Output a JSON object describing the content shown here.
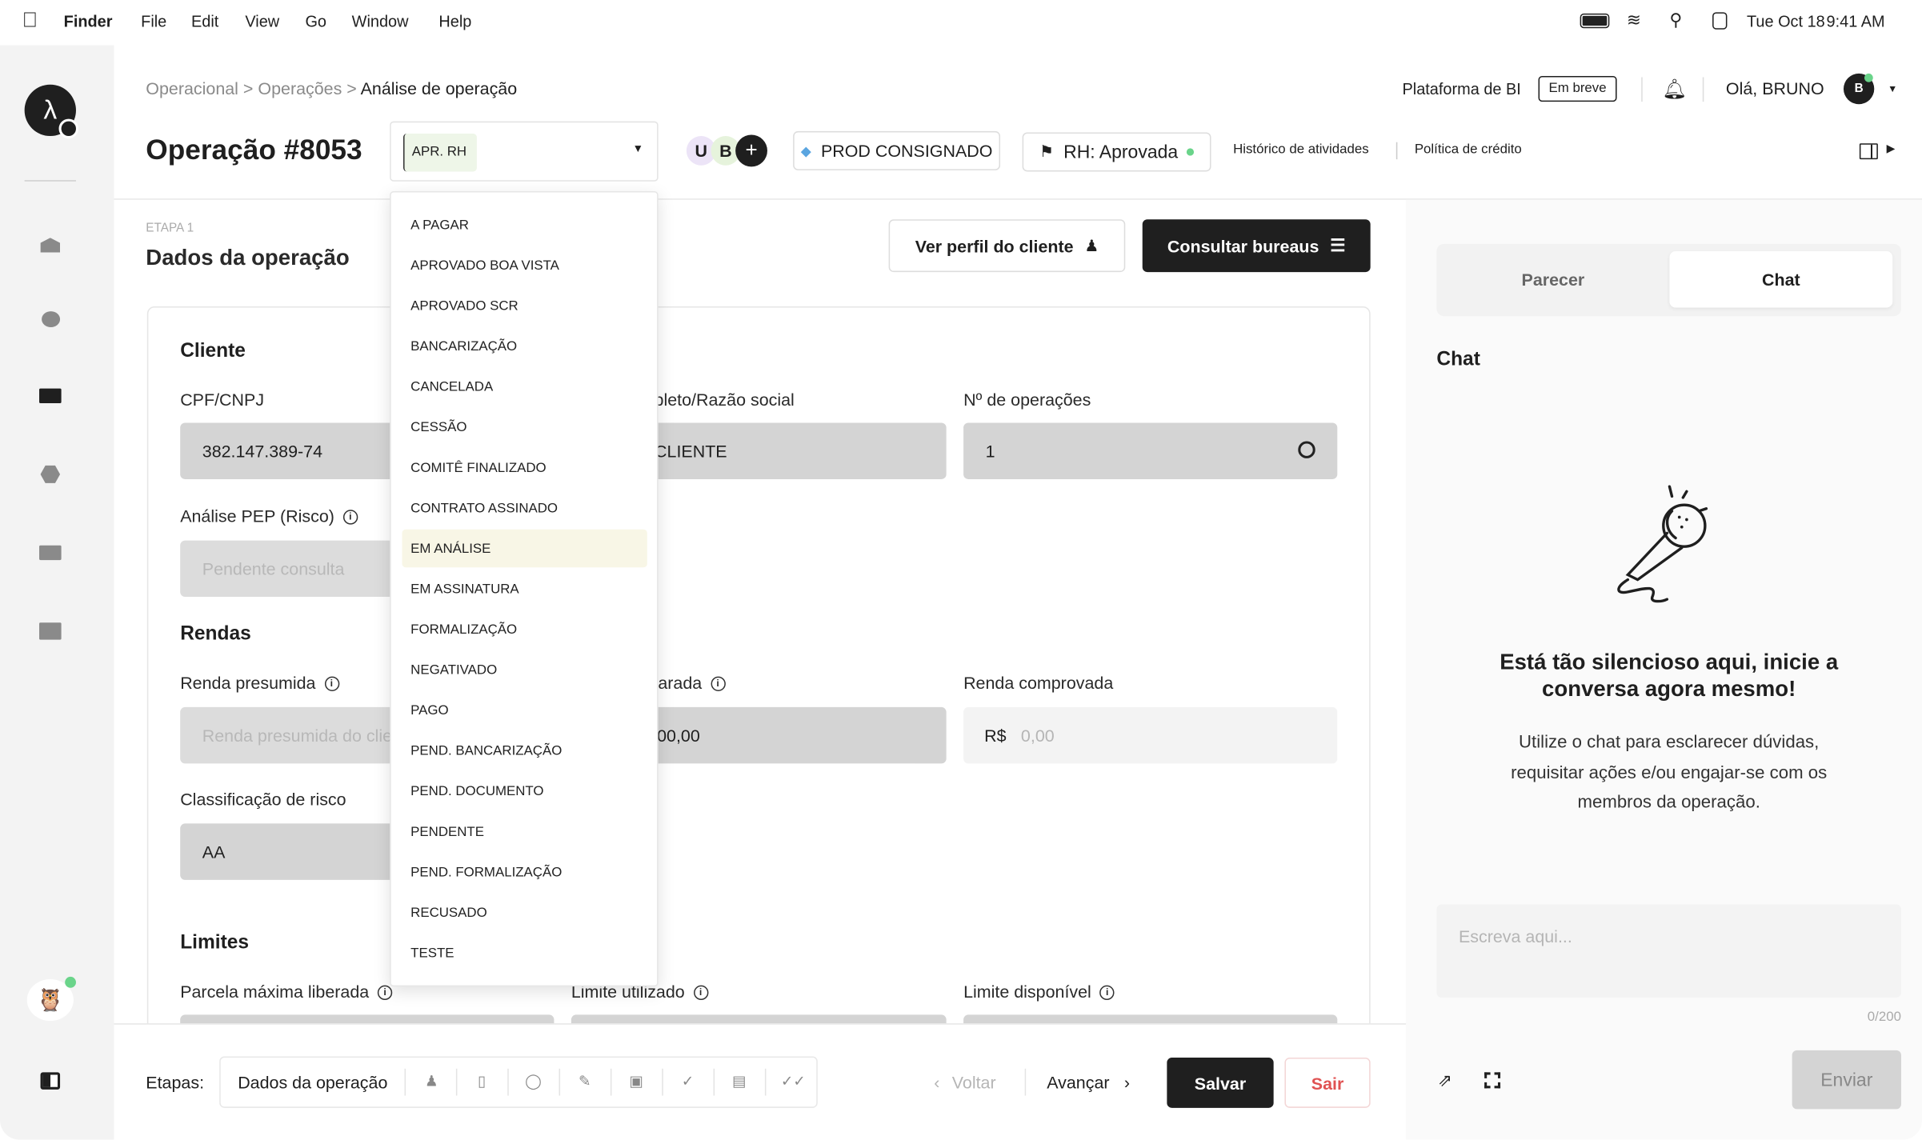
{
  "menubar": {
    "app": "Finder",
    "items": [
      "File",
      "Edit",
      "View",
      "Go",
      "Window",
      "Help"
    ],
    "date": "Tue Oct 18",
    "time": "9:41 AM"
  },
  "breadcrumb": {
    "items": [
      "Operacional",
      "Operações"
    ],
    "separator": ">",
    "current": "Análise de operação"
  },
  "header": {
    "title": "Operação #8053",
    "status_select": {
      "value": "APR. RH"
    },
    "avatars": [
      "U",
      "B"
    ],
    "add_label": "+",
    "product_tag": "PROD CONSIGNADO",
    "rh_status": "RH: Aprovada",
    "link_history": "Histórico de atividades",
    "link_policy": "Política de crédito",
    "bi_label": "Plataforma de BI",
    "bi_badge": "Em breve",
    "greeting": "Olá, BRUNO",
    "user_initial": "B"
  },
  "status_options": [
    "A PAGAR",
    "APROVADO BOA VISTA",
    "APROVADO SCR",
    "BANCARIZAÇÃO",
    "CANCELADA",
    "CESSÃO",
    "COMITÊ FINALIZADO",
    "CONTRATO ASSINADO",
    "EM ANÁLISE",
    "EM ASSINATURA",
    "FORMALIZAÇÃO",
    "NEGATIVADO",
    "PAGO",
    "PEND. BANCARIZAÇÃO",
    "PEND. DOCUMENTO",
    "PENDENTE",
    "PEND. FORMALIZAÇÃO",
    "RECUSADO",
    "TESTE"
  ],
  "highlighted_option": "EM ANÁLISE",
  "stage": {
    "step": "ETAPA 1",
    "title": "Dados da operação",
    "btn_profile": "Ver perfil do cliente",
    "btn_bureaus": "Consultar bureaus"
  },
  "form": {
    "cliente": {
      "title": "Cliente",
      "cpf_label": "CPF/CNPJ",
      "cpf_value": "382.147.389-74",
      "name_label": "Nome completo/Razão social",
      "name_value": "CLIENTE",
      "ops_label": "Nº de operações",
      "ops_value": "1",
      "pep_label": "Análise PEP (Risco)",
      "pep_placeholder": "Pendente consulta"
    },
    "rendas": {
      "title": "Rendas",
      "presumida_label": "Renda presumida",
      "presumida_placeholder": "Renda presumida do cliente",
      "declarada_label": "Renda declarada",
      "declarada_value": "00,00",
      "comprovada_label": "Renda comprovada",
      "currency": "R$",
      "comprovada_placeholder": "0,00",
      "risco_label": "Classificação de risco",
      "risco_value": "AA"
    },
    "limites": {
      "title": "Limites",
      "parcela_label": "Parcela máxima liberada",
      "utilizado_label": "Limite utilizado",
      "disponivel_label": "Limite disponível"
    }
  },
  "footer": {
    "steps_label": "Etapas:",
    "current_step": "Dados da operação",
    "back": "Voltar",
    "next": "Avançar",
    "save": "Salvar",
    "exit": "Sair"
  },
  "chat": {
    "tabs": [
      "Parecer",
      "Chat"
    ],
    "active_tab": "Chat",
    "heading": "Chat",
    "empty_title": "Está tão silencioso aqui, inicie a conversa agora mesmo!",
    "empty_desc": "Utilize o chat para esclarecer dúvidas, requisitar ações e/ou engajar-se com os membros da operação.",
    "placeholder": "Escreva aqui...",
    "counter": "0/200",
    "send": "Enviar"
  },
  "colors": {
    "primary": "#1f1f1f",
    "danger": "#e05252",
    "online": "#6ad48a",
    "input_bg": "#d4d4d4",
    "highlight": "#f8f6e6"
  }
}
